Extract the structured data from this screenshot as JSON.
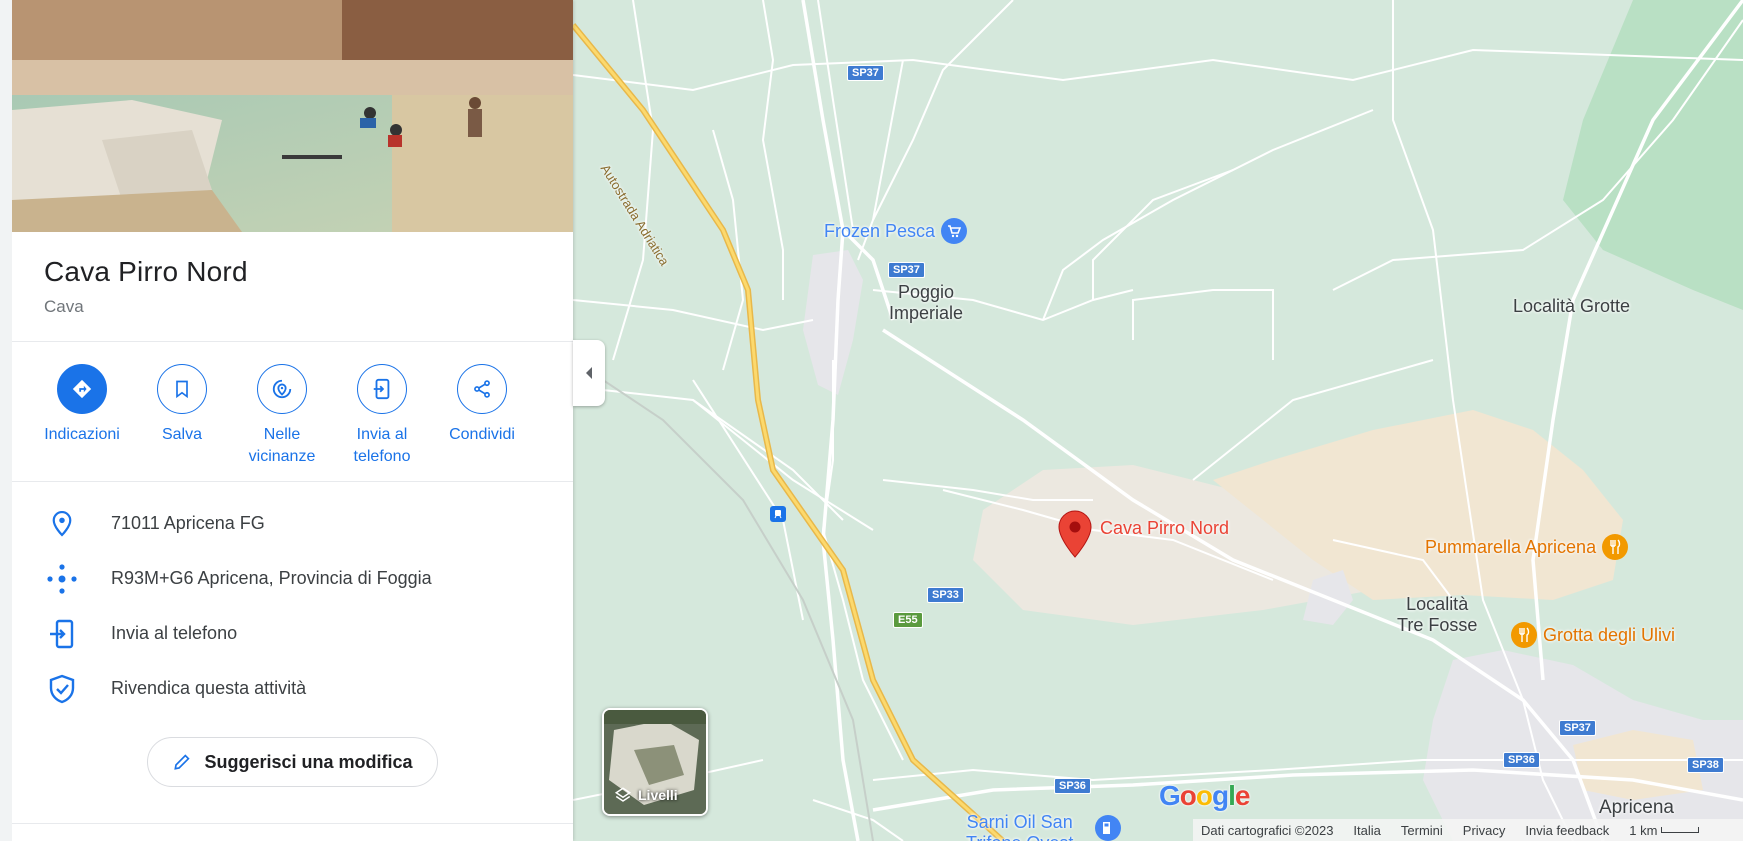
{
  "place": {
    "title": "Cava Pirro Nord",
    "category": "Cava"
  },
  "actions": [
    {
      "label": "Indicazioni",
      "icon": "directions-icon"
    },
    {
      "label": "Salva",
      "icon": "bookmark-icon"
    },
    {
      "label": "Nelle vicinanze",
      "icon": "nearby-icon"
    },
    {
      "label": "Invia al telefono",
      "icon": "send-to-phone-icon"
    },
    {
      "label": "Condividi",
      "icon": "share-icon"
    }
  ],
  "info": {
    "address": "71011 Apricena FG",
    "plus_code": "R93M+G6 Apricena, Provincia di Foggia",
    "send_to_phone": "Invia al telefono",
    "claim": "Rivendica questa attività"
  },
  "suggest_edit": "Suggerisci una modifica",
  "map": {
    "labels": {
      "frozen_pesca": "Frozen Pesca",
      "poggio": "Poggio\nImperiale",
      "localita_grotte": "Località Grotte",
      "cava_pirro": "Cava Pirro Nord",
      "pummarella": "Pummarella Apricena",
      "tre_fosse": "Località\nTre Fosse",
      "grotta_ulivi": "Grotta degli Ulivi",
      "apricena": "Apricena",
      "sarni": "Sarni Oil San\nTrifone Ovest",
      "autostrada": "Autostrada Adriatica"
    },
    "shields": {
      "sp37_top": "SP37",
      "sp37_mid": "SP37",
      "sp33": "SP33",
      "e55": "E55",
      "sp36_left": "SP36",
      "sp36_right": "SP36",
      "sp37_right": "SP37",
      "sp38": "SP38"
    },
    "layers_label": "Livelli",
    "google_logo": "Google",
    "footer": {
      "data": "Dati cartografici ©2023",
      "country": "Italia",
      "terms": "Termini",
      "privacy": "Privacy",
      "feedback": "Invia feedback",
      "scale": "1 km"
    }
  },
  "colors": {
    "accent": "#1a73e8",
    "marker": "#ea4335",
    "poi_food": "#f29900",
    "map_bg": "#d5e8dc"
  }
}
